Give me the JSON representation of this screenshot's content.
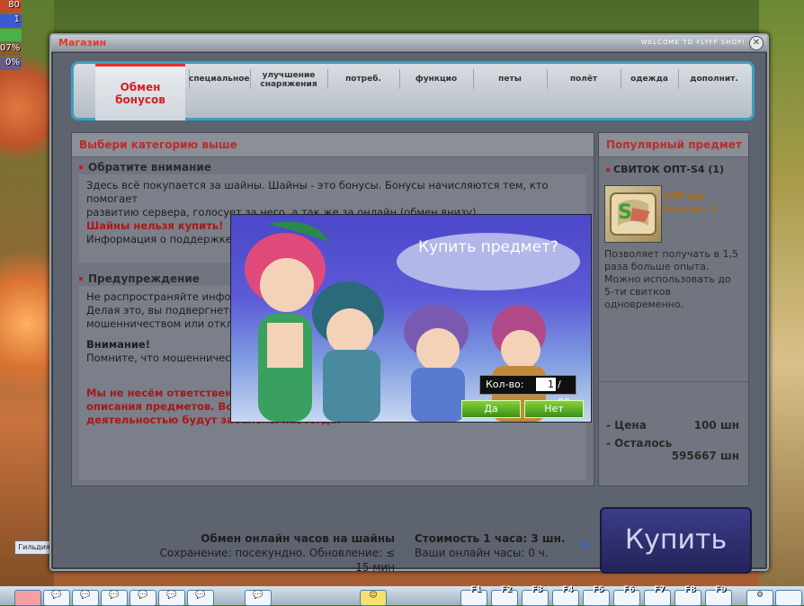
{
  "hud": [
    "80",
    "1",
    "",
    "07%",
    "0%"
  ],
  "window": {
    "title": "Магазин",
    "subtitle": "WELCOME TO FLYFF SHOP!"
  },
  "tabs": [
    {
      "label": "Обмен бонусов",
      "active": true
    },
    {
      "label": "специальное"
    },
    {
      "label": "улучшение снаряжения"
    },
    {
      "label": "потреб."
    },
    {
      "label": "функцио"
    },
    {
      "label": "петы"
    },
    {
      "label": "полёт"
    },
    {
      "label": "одежда"
    },
    {
      "label": "дополнит."
    }
  ],
  "left_panel": {
    "heading": "Выбери категорию выше",
    "notice_title": "Обратите внимание",
    "notice_line1": "Здесь всё покупается за шайны. Шайны - это бонусы. Бонусы начисляются тем, кто помогает",
    "notice_line2": "развитию сервера, голосует за него, а так же за онлайн (обмен внизу).",
    "notice_red": "Шайны нельзя купить!",
    "notice_line3": "Информация о поддержке",
    "warning_title": "Предупреждение",
    "warning_line1": "Не распространяйте информ",
    "warning_line2": "Делая это, вы подвергнете",
    "warning_line3": "мошенничеством или отклон",
    "attention": "Внимание!",
    "attention_line": "Помните, что мошенническ",
    "red_line1": "Мы не несём ответственно",
    "red_line2": "описания предметов. Все а",
    "red_line3": "деятельностью будут забанены навсегда."
  },
  "right_panel": {
    "heading": "Популярный предмет",
    "item_name": "СВИТОК ОПТ-S4 (1)",
    "price_line": "100 шн",
    "qty_line": "Кол-во: 1",
    "description": "Позволяет получать в 1,5 раза больше опыта. Можно использовать до 5-ти свитков одновременно.",
    "price_label": "- Цена",
    "price_value": "100 шн",
    "left_label": "- Осталось",
    "left_value": "595667 шн",
    "buy_label": "Купить"
  },
  "footer": {
    "exchange_title": "Обмен онлайн часов на шайны",
    "exchange_sub": "Сохранение: посекундно. Обновление: ≤ 15 мин",
    "cost": "Стоимость 1 часа: 3 шн.",
    "hours": "Ваши онлайн часы: 0 ч."
  },
  "modal": {
    "question": "Купить предмет?",
    "qty_label": "Кол-во:",
    "qty_value": "1",
    "qty_max": "/ 99",
    "yes": "Да",
    "no": "Нет"
  },
  "bottom": {
    "guild": "Гильдия",
    "fkeys": [
      "F1",
      "F2",
      "F3",
      "F4",
      "F5",
      "F6",
      "F7",
      "F8",
      "F9"
    ]
  },
  "colors": {
    "accent_red": "#c02a2a",
    "tab_border": "#3aa0c0",
    "buy_bg": "#2d2d6e",
    "modal_btn": "#5cb229"
  }
}
